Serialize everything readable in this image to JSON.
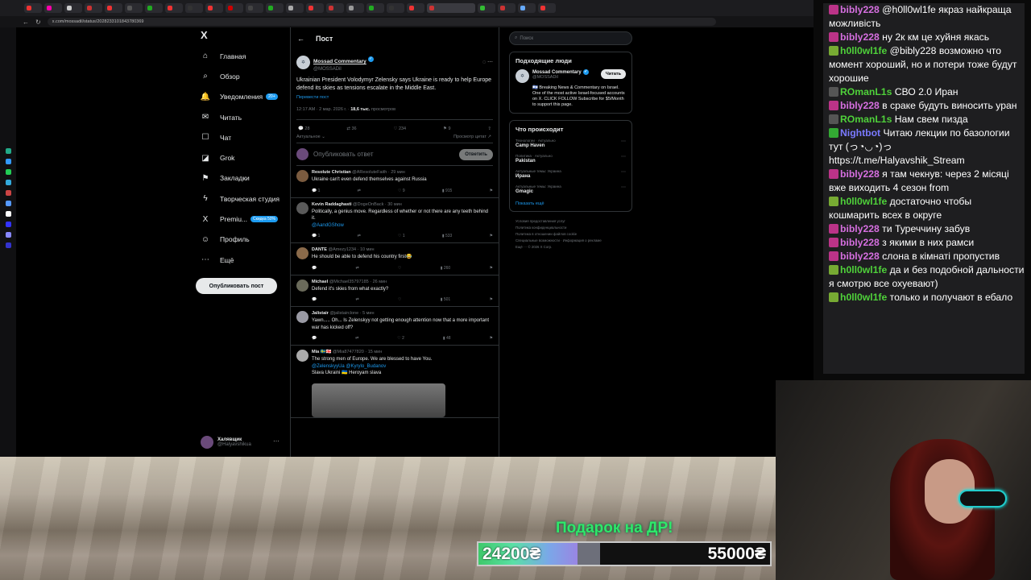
{
  "browser": {
    "url": "x.com/mossadil/status/2028233101843780369",
    "tabs": [
      {
        "color": "#e33"
      },
      {
        "color": "#f0a"
      },
      {
        "color": "#ccc"
      },
      {
        "color": "#c33"
      },
      {
        "color": "#e33"
      },
      {
        "color": "#555"
      },
      {
        "color": "#2a2"
      },
      {
        "color": "#e33"
      },
      {
        "color": "#333"
      },
      {
        "color": "#e33"
      },
      {
        "color": "#c00"
      },
      {
        "color": "#444"
      },
      {
        "color": "#2a2"
      },
      {
        "color": "#aaa"
      },
      {
        "color": "#e33"
      },
      {
        "color": "#c33"
      },
      {
        "color": "#999"
      },
      {
        "color": "#2a2"
      },
      {
        "color": "#333"
      },
      {
        "color": "#e33"
      },
      {
        "color": "#c33"
      },
      {
        "color": "#3b3"
      },
      {
        "color": "#c33"
      },
      {
        "color": "#6af"
      },
      {
        "color": "#e33"
      }
    ],
    "rail_colors": [
      "#2a8",
      "#39f",
      "#2c5",
      "#3ad",
      "#c44",
      "#59f",
      "#fff",
      "#33f",
      "#88f",
      "#33c"
    ]
  },
  "sidebar": {
    "logo": "X",
    "items": [
      {
        "icon": "⌂",
        "label": "Главная"
      },
      {
        "icon": "⌕",
        "label": "Обзор"
      },
      {
        "icon": "🔔",
        "label": "Уведомления",
        "badge": "20+"
      },
      {
        "icon": "✉",
        "label": "Читать"
      },
      {
        "icon": "☐",
        "label": "Чат"
      },
      {
        "icon": "◪",
        "label": "Grok"
      },
      {
        "icon": "⚑",
        "label": "Закладки"
      },
      {
        "icon": "ϟ",
        "label": "Творческая студия"
      },
      {
        "icon": "X",
        "label": "Premiu...",
        "badge": "Скидка 50%"
      },
      {
        "icon": "☺",
        "label": "Профиль"
      },
      {
        "icon": "⋯",
        "label": "Ещё"
      }
    ],
    "post_button": "Опубликовать пост",
    "account_name": "Халявщик",
    "account_handle": "@Halyavshikua",
    "more": "⋯"
  },
  "main": {
    "back": "←",
    "title": "Пост",
    "post": {
      "name": "Mossad Commentary",
      "handle": "@MOSSADil",
      "text": "Ukrainian President Volodymyr Zelensky says Ukraine is ready to help Europe defend its skies as tensions escalate in the Middle East.",
      "translate": "Перевести пост",
      "time": "12:17 AM · 2 мар. 2026 г. · ",
      "views": "18,6 тыс.",
      "views_label": " просмотров",
      "replies": "28",
      "reposts": "36",
      "likes": "234",
      "bookmarks": "9",
      "sort_left": "Актуальное ⌄",
      "sort_right": "Просмотр цитат ↗"
    },
    "reply_placeholder": "Опубликовать ответ",
    "reply_button": "Ответить",
    "comments": [
      {
        "name": "Resolute Christian",
        "handle": "@AResoluteFaith · 29 мин",
        "text": "Ukraine can't even defend themselves against Russia",
        "link": "",
        "r": "1",
        "rt": "",
        "l": "9",
        "v": "915",
        "avatar": "#7b5b3f"
      },
      {
        "name": "Kevin Raddaghasti",
        "handle": "@DogeOnBack · 30 мин",
        "text": "Politically, a genius move. Regardless of whether or not there are any teeth behind it.",
        "link": "@AandGShow",
        "r": "1",
        "rt": "",
        "l": "1",
        "v": "533",
        "avatar": "#5a5a5a"
      },
      {
        "name": "DANTE",
        "handle": "@Amezy1234 · 10 мин",
        "text": "He should be able to defend his country first😂",
        "link": "",
        "r": "",
        "rt": "",
        "l": "",
        "v": "260",
        "avatar": "#8a6a4a"
      },
      {
        "name": "Michael",
        "handle": "@Michael35797185 · 26 мин",
        "text": "Defend it's skies from what exactly?",
        "link": "",
        "r": "",
        "rt": "",
        "l": "",
        "v": "501",
        "avatar": "#6a6a5a"
      },
      {
        "name": "Jalistair",
        "handle": "@jalistairclone · 5 мин",
        "text": "Yawn..... Oh... Is Zelenskyy not getting enough attention now that a more important war has kicked off?",
        "link": "",
        "r": "",
        "rt": "",
        "l": "2",
        "v": "48",
        "avatar": "#9a9aa4"
      },
      {
        "name": "Mia 🇸🇪🇬🇪",
        "handle": "@Mia87477820 · 15 мин",
        "text": "The strong men of Europe. We are blessed to have You.",
        "link": "@ZelenskyyUa @Kyrylo_Budanov",
        "extra": "Slava Ukraini 🇺🇦 Heroyam slava",
        "r": "",
        "rt": "",
        "l": "",
        "v": "",
        "avatar": "#aaa"
      }
    ]
  },
  "right": {
    "search_placeholder": "Поиск",
    "who_title": "Подходящие люди",
    "who_name": "Mossad Commentary",
    "who_handle": "@MOSSADil",
    "follow": "Читать",
    "bio": "🇮🇱 Breaking News & Commentary on Israel. One of the most active Israel-focused accounts on X. CLICK FOLLOW Subscribe for $5/Month to support this page.",
    "trends_title": "Что происходит",
    "trends": [
      {
        "ctx": "Технологии · Актуально",
        "title": "Camp Haven"
      },
      {
        "ctx": "Политика · Актуально",
        "title": "Pakistan"
      },
      {
        "ctx": "Актуальные темы: Украина",
        "title": "Ирана"
      },
      {
        "ctx": "Актуальные темы: Украина",
        "title": "Gmagic"
      }
    ],
    "show_more": "Показать ещё",
    "footer": [
      "Условия предоставления услуг",
      "Политика конфиденциальности",
      "Политика в отношении файлов cookie",
      "Специальные возможности · Информация о рекламе",
      "Ещё ··· © 2026 X Corp."
    ]
  },
  "stream": {
    "gift_label": "Подарок на ДР!",
    "progress_current": "24200₴",
    "progress_goal": "55000₴",
    "progress_fraction": 0.36
  },
  "chat": [
    {
      "user": "bibly228",
      "color": "#d66fe0",
      "text": "@h0ll0wl1fe якраз найкраща можливість",
      "badge": "#b38"
    },
    {
      "user": "bibly228",
      "color": "#d66fe0",
      "text": "ну 2к км це хуйня якась",
      "badge": "#b38"
    },
    {
      "user": "h0ll0wl1fe",
      "color": "#4fd13a",
      "text": "@bibly228 возможно что момент хороший, но и потери тоже будут хорошие",
      "badge": "#7a3"
    },
    {
      "user": "ROmanL1s",
      "color": "#4fd13a",
      "text": "СВО 2.0 Иран",
      "badge": "#555"
    },
    {
      "user": "bibly228",
      "color": "#d66fe0",
      "text": "в сраке будуть виносить уран",
      "badge": "#b38"
    },
    {
      "user": "ROmanL1s",
      "color": "#4fd13a",
      "text": "Нам свем пизда",
      "badge": "#555"
    },
    {
      "user": "Nightbot",
      "color": "#7a7aff",
      "text": "Читаю лекции по базологии тут (っ◔◡◔)っ https://t.me/Halyavshik_Stream",
      "badge": "#3a3"
    },
    {
      "user": "bibly228",
      "color": "#d66fe0",
      "text": "я там чекнув: через 2 місяці вже виходить 4 сезон from",
      "badge": "#b38"
    },
    {
      "user": "h0ll0wl1fe",
      "color": "#4fd13a",
      "text": "достаточно чтобы кошмарить всех в округе",
      "badge": "#7a3"
    },
    {
      "user": "bibly228",
      "color": "#d66fe0",
      "text": "ти Туреччину забув",
      "badge": "#b38"
    },
    {
      "user": "bibly228",
      "color": "#d66fe0",
      "text": "з якими в них рамси",
      "badge": "#b38"
    },
    {
      "user": "bibly228",
      "color": "#d66fe0",
      "text": "слона в кімнаті пропустив",
      "badge": "#b38"
    },
    {
      "user": "h0ll0wl1fe",
      "color": "#4fd13a",
      "text": "да и без подобной дальности я смотрю все охуевают)",
      "badge": "#7a3"
    },
    {
      "user": "h0ll0wl1fe",
      "color": "#4fd13a",
      "text": "только и получают в ебало",
      "badge": "#7a3"
    }
  ]
}
